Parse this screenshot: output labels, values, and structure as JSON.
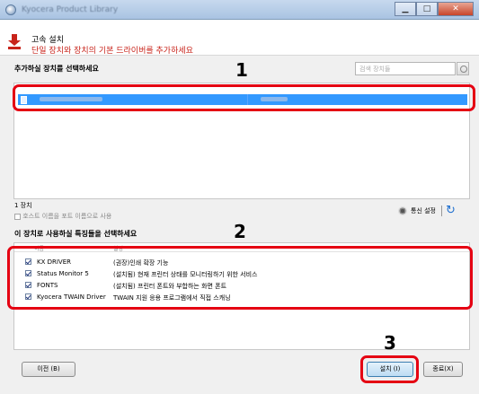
{
  "window": {
    "title": "Kyocera Product Library"
  },
  "header": {
    "title": "고속 설치",
    "subtitle": "단일 장치와 장치의 기본 드라이버를 추가하세요"
  },
  "device_section": {
    "label": "추가하실 장치를 선택하세요",
    "search_placeholder": "검색 장치들",
    "count_text": "1 장치",
    "host_option_label": "호스트 이름을 포트 이름으로 사용",
    "host_option_checked": false,
    "comm_settings_label": "통신 설정"
  },
  "features_section": {
    "label": "이 장치로 사용하실 특징들을 선택하세요",
    "columns": [
      "이름",
      "설명"
    ],
    "rows": [
      {
        "name": "KX DRIVER",
        "desc": "(권장)인쇄 확장 기능",
        "checked": true
      },
      {
        "name": "Status Monitor 5",
        "desc": "(설치됨) 현재 프린터 상태를 모니터링하기 위한 서비스",
        "checked": true
      },
      {
        "name": "FONTS",
        "desc": "(설치됨) 프린터 폰트와 부합하는 화면 폰트",
        "checked": true
      },
      {
        "name": "Kyocera TWAIN Driver",
        "desc": "TWAIN 지원 응용 프로그램에서 직접 스캐닝",
        "checked": true
      }
    ]
  },
  "buttons": {
    "back": "이전 (B)",
    "install": "설치 (I)",
    "close": "종료(X)"
  },
  "callouts": [
    "1",
    "2",
    "3"
  ],
  "colors": {
    "accent_red": "#e50012",
    "selection_blue": "#3399ff",
    "header_red": "#c8231a"
  }
}
